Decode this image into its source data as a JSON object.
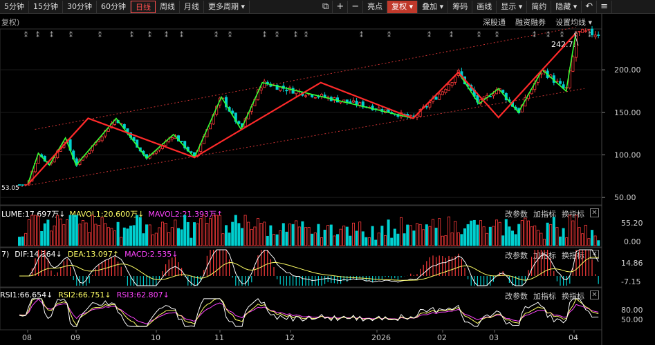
{
  "toolbar": {
    "periods": [
      "5分钟",
      "15分钟",
      "30分钟",
      "60分钟",
      "日线",
      "周线",
      "月线",
      "更多周期 ▾"
    ],
    "active_period": "日线",
    "tools": [
      "亮点",
      "复权 ▾",
      "叠加 ▾",
      "筹码",
      "画线",
      "显示 ▾",
      "简约",
      "隐藏 ▾"
    ],
    "active_tool": "复权 ▾"
  },
  "main_panel": {
    "left_label": "复权)",
    "right_links": [
      "深股通",
      "融资融券",
      "设置均线 ▾"
    ],
    "high_label": "242.78",
    "low_label": "53.05",
    "marker_symbol": "⁑"
  },
  "volume_panel": {
    "indicators": [
      {
        "text": "LUME:17.697万↓",
        "color": "#ffffff"
      },
      {
        "text": "MAVOL1:20.600万↓",
        "color": "#ffff66"
      },
      {
        "text": "MAVOL2:21.393万↑",
        "color": "#ff44ff"
      }
    ],
    "buttons": [
      "改参数",
      "加指标",
      "换指标"
    ],
    "y_ticks": [
      "55.20",
      "0.00"
    ]
  },
  "macd_panel": {
    "prefix": "7)",
    "indicators": [
      {
        "text": "DIF:14.364↓",
        "color": "#ffffff"
      },
      {
        "text": "DEA:13.097↑",
        "color": "#ffff66"
      },
      {
        "text": "MACD:2.535↓",
        "color": "#ff44ff"
      }
    ],
    "buttons": [
      "改参数",
      "加指标",
      "换指标"
    ],
    "y_ticks": [
      "14.86",
      "-7.15"
    ]
  },
  "rsi_panel": {
    "indicators": [
      {
        "text": "RSI1:66.654↓",
        "color": "#ffffff"
      },
      {
        "text": "RSI2:66.751↓",
        "color": "#ffff66"
      },
      {
        "text": "RSI3:62.807↓",
        "color": "#ff44ff"
      }
    ],
    "buttons": [
      "改参数",
      "加指标",
      "换指标"
    ],
    "y_ticks": [
      "80.00",
      "50.00"
    ]
  },
  "x_axis": [
    "08",
    "09",
    "10",
    "11",
    "12",
    "2026",
    "02",
    "03",
    "04"
  ],
  "colors": {
    "up": "#ff3b3b",
    "down": "#00d0d0",
    "green_line": "#33ff33",
    "red_line": "#ff2a2a",
    "channel": "#cc3333"
  },
  "chart_data": {
    "type": "candlestick",
    "y_ticks_main": [
      50,
      100,
      150,
      200
    ],
    "ylim_main": [
      42,
      248
    ],
    "zigzag_red": [
      {
        "m": 0.0,
        "p": 65
      },
      {
        "m": 1.15,
        "p": 143
      },
      {
        "m": 2.6,
        "p": 97
      },
      {
        "m": 4.35,
        "p": 185
      },
      {
        "m": 5.55,
        "p": 143
      },
      {
        "m": 6.3,
        "p": 197
      },
      {
        "m": 7.05,
        "p": 144
      },
      {
        "m": 8.05,
        "p": 243
      }
    ],
    "zigzag_green": [
      {
        "m": 0.0,
        "p": 65
      },
      {
        "m": 0.22,
        "p": 102
      },
      {
        "m": 0.45,
        "p": 88
      },
      {
        "m": 0.78,
        "p": 120
      },
      {
        "m": 1.0,
        "p": 88
      },
      {
        "m": 1.5,
        "p": 143
      },
      {
        "m": 1.88,
        "p": 96
      },
      {
        "m": 2.27,
        "p": 124
      },
      {
        "m": 2.6,
        "p": 97
      },
      {
        "m": 3.02,
        "p": 168
      },
      {
        "m": 3.3,
        "p": 130
      },
      {
        "m": 3.6,
        "p": 185
      },
      {
        "m": 5.55,
        "p": 143
      },
      {
        "m": 6.3,
        "p": 197
      },
      {
        "m": 6.7,
        "p": 160
      },
      {
        "m": 7.05,
        "p": 178
      },
      {
        "m": 7.3,
        "p": 150
      },
      {
        "m": 7.6,
        "p": 200
      },
      {
        "m": 7.9,
        "p": 175
      },
      {
        "m": 8.05,
        "p": 243
      }
    ],
    "channel_upper": [
      {
        "m": 0.15,
        "p": 130
      },
      {
        "m": 8.05,
        "p": 250
      }
    ],
    "channel_lower": [
      {
        "m": -0.2,
        "p": 62
      },
      {
        "m": 8.3,
        "p": 178
      }
    ],
    "volume_ylim": [
      0,
      55.2
    ],
    "macd_ylim": [
      -7.15,
      14.86
    ],
    "rsi_ylim": [
      20,
      100
    ]
  }
}
